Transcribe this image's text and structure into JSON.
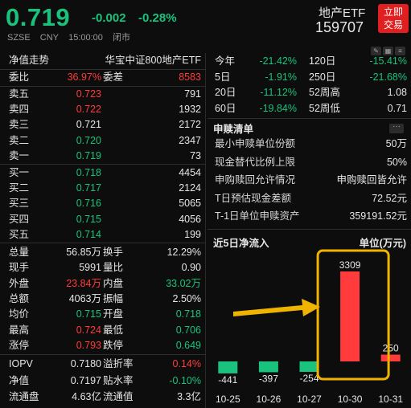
{
  "header": {
    "price": "0.719",
    "change": "-0.002",
    "change_pct": "-0.28%",
    "exchange": "SZSE",
    "currency": "CNY",
    "time": "15:00:00",
    "status": "闭市",
    "fund_name": "地产ETF",
    "fund_code": "159707",
    "trade_button_line1": "立即",
    "trade_button_line2": "交易"
  },
  "left": {
    "trend_label": "净值走势",
    "index_name": "华宝中证800地产ETF",
    "weibi_label": "委比",
    "weibi_value": "36.97%",
    "weicha_label": "委差",
    "weicha_value": "8583",
    "asks": [
      {
        "label": "卖五",
        "price": "0.723",
        "vol": "791",
        "color": "red"
      },
      {
        "label": "卖四",
        "price": "0.722",
        "vol": "1932",
        "color": "red"
      },
      {
        "label": "卖三",
        "price": "0.721",
        "vol": "2172",
        "color": "white"
      },
      {
        "label": "卖二",
        "price": "0.720",
        "vol": "2347",
        "color": "green"
      },
      {
        "label": "卖一",
        "price": "0.719",
        "vol": "73",
        "color": "green"
      }
    ],
    "bids": [
      {
        "label": "买一",
        "price": "0.718",
        "vol": "4454",
        "color": "green"
      },
      {
        "label": "买二",
        "price": "0.717",
        "vol": "2124",
        "color": "green"
      },
      {
        "label": "买三",
        "price": "0.716",
        "vol": "5065",
        "color": "green"
      },
      {
        "label": "买四",
        "price": "0.715",
        "vol": "4056",
        "color": "green"
      },
      {
        "label": "买五",
        "price": "0.714",
        "vol": "199",
        "color": "green"
      }
    ],
    "stats": [
      {
        "l1": "总量",
        "v1": "56.85万",
        "c1": "white",
        "l2": "换手",
        "v2": "12.29%",
        "c2": "white"
      },
      {
        "l1": "现手",
        "v1": "5991",
        "c1": "white",
        "l2": "量比",
        "v2": "0.90",
        "c2": "white"
      },
      {
        "l1": "外盘",
        "v1": "23.84万",
        "c1": "red",
        "l2": "内盘",
        "v2": "33.02万",
        "c2": "green"
      },
      {
        "l1": "总额",
        "v1": "4063万",
        "c1": "white",
        "l2": "振幅",
        "v2": "2.50%",
        "c2": "white"
      },
      {
        "l1": "均价",
        "v1": "0.715",
        "c1": "green",
        "l2": "开盘",
        "v2": "0.718",
        "c2": "green"
      },
      {
        "l1": "最高",
        "v1": "0.724",
        "c1": "red",
        "l2": "最低",
        "v2": "0.706",
        "c2": "green"
      },
      {
        "l1": "涨停",
        "v1": "0.793",
        "c1": "red",
        "l2": "跌停",
        "v2": "0.649",
        "c2": "green"
      }
    ],
    "bottom": [
      {
        "l1": "IOPV",
        "v1": "0.7180",
        "c1": "white",
        "l2": "溢折率",
        "v2": "0.14%",
        "c2": "red"
      },
      {
        "l1": "净值",
        "v1": "0.7197",
        "c1": "white",
        "l2": "贴水率",
        "v2": "-0.10%",
        "c2": "green"
      },
      {
        "l1": "流通盘",
        "v1": "4.63亿",
        "c1": "white",
        "l2": "流通值",
        "v2": "3.3亿",
        "c2": "white"
      }
    ]
  },
  "right": {
    "perf": [
      {
        "l1": "今年",
        "v1": "-21.42%",
        "l2": "120日",
        "v2": "-15.41%",
        "c1": "green",
        "c2": "green"
      },
      {
        "l1": "5日",
        "v1": "-1.91%",
        "l2": "250日",
        "v2": "-21.68%",
        "c1": "green",
        "c2": "green"
      },
      {
        "l1": "20日",
        "v1": "-11.12%",
        "l2": "52周高",
        "v2": "1.08",
        "c1": "green",
        "c2": "white"
      },
      {
        "l1": "60日",
        "v1": "-19.84%",
        "l2": "52周低",
        "v2": "0.71",
        "c1": "green",
        "c2": "white"
      }
    ],
    "subscription_title": "申赎清单",
    "subscription": [
      {
        "label": "最小申赎单位份额",
        "value": "50万"
      },
      {
        "label": "现金替代比例上限",
        "value": "50%"
      },
      {
        "label": "申购赎回允许情况",
        "value": "申购赎回皆允许"
      },
      {
        "label": "T日预估现金差额",
        "value": "72.52元"
      },
      {
        "label": "T-1日单位申赎资产",
        "value": "359191.52元"
      }
    ]
  },
  "chart_data": {
    "type": "bar",
    "title": "近5日净流入",
    "unit_label": "单位(万元)",
    "categories": [
      "10-25",
      "10-26",
      "10-27",
      "10-30",
      "10-31"
    ],
    "values": [
      -441,
      -397,
      -254,
      3309,
      250
    ],
    "colors": {
      "positive": "#ff3b3b",
      "negative": "#19c37d",
      "highlight": "#f0b400",
      "arrow": "#f0b400"
    }
  }
}
